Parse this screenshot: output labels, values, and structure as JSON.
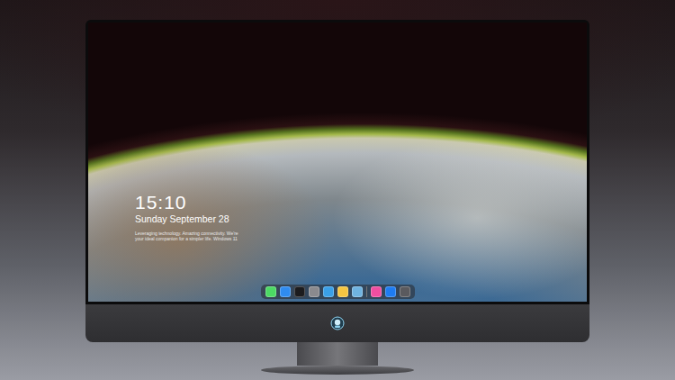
{
  "lockscreen": {
    "time": "15:10",
    "date": "Sunday September 28",
    "tagline": [
      "Leveraging technology. Amazing connectivity. We're",
      "your ideal companion for a simpler life. Windows 11"
    ]
  },
  "dock": {
    "items": [
      {
        "kind": "app",
        "color": "#4cd964"
      },
      {
        "kind": "app",
        "color": "#2f8cf0"
      },
      {
        "kind": "app",
        "color": "#1c1c1e"
      },
      {
        "kind": "app",
        "color": "#8a8a8e"
      },
      {
        "kind": "app",
        "color": "#3aa0e8"
      },
      {
        "kind": "app",
        "color": "#f5c542"
      },
      {
        "kind": "app",
        "color": "#6fb3e0"
      },
      {
        "kind": "separator",
        "color": "#777777"
      },
      {
        "kind": "app",
        "color": "#f04ea0"
      },
      {
        "kind": "app",
        "color": "#1e7cf2"
      },
      {
        "kind": "app",
        "color": "#5a5a5e"
      }
    ]
  }
}
